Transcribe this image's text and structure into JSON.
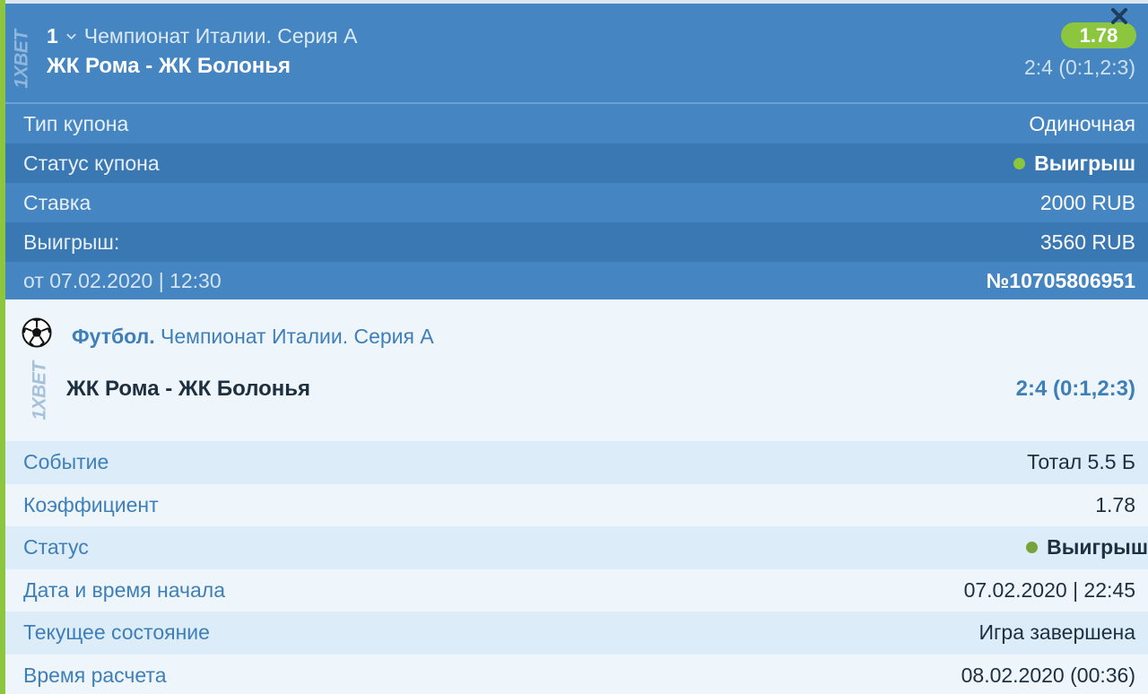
{
  "coupon": {
    "logo": "1XBET",
    "bet_number": "1",
    "league": "Чемпионат Италии. Серия А",
    "match": "ЖК Рома - ЖК Болонья",
    "odds": "1.78",
    "score": "2:4 (0:1,2:3)",
    "close_icon": "close-icon",
    "rows": [
      {
        "label": "Тип купона",
        "value": "Одиночная"
      },
      {
        "label": "Статус купона",
        "value": "Выигрыш"
      },
      {
        "label": "Ставка",
        "value": "2000 RUB"
      },
      {
        "label": "Выигрыш:",
        "value": "3560 RUB"
      }
    ],
    "date": "от 07.02.2020 | 12:30",
    "number": "№10705806951"
  },
  "event": {
    "sport_icon": "soccer-ball-icon",
    "sport": "Футбол.",
    "league": "Чемпионат Италии. Серия А",
    "logo": "1XBET",
    "match": "ЖК Рома - ЖК Болонья",
    "score": "2:4 (0:1,2:3)",
    "rows": [
      {
        "label": "Событие",
        "value": "Тотал 5.5 Б"
      },
      {
        "label": "Коэффициент",
        "value": "1.78"
      },
      {
        "label": "Статус",
        "value": "Выигрыш"
      },
      {
        "label": "Дата и время начала",
        "value": "07.02.2020 | 22:45"
      },
      {
        "label": "Текущее состояние",
        "value": "Игра завершена"
      },
      {
        "label": "Время расчета",
        "value": "08.02.2020 (00:36)"
      }
    ]
  },
  "colors": {
    "header_blue": "#4485c2",
    "header_blue_dark": "#3a78b3",
    "accent_green": "#8cc63f",
    "link_blue": "#3f7fb9",
    "text_dark": "#1e2f40"
  }
}
